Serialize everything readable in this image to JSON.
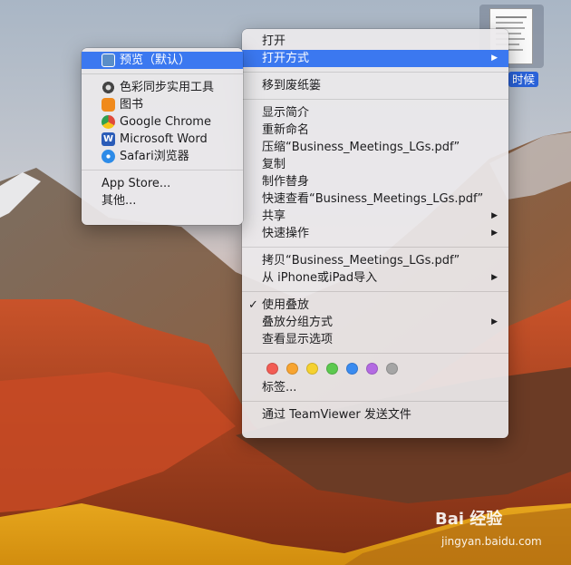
{
  "colors": {
    "accent": "#3b78f0",
    "selection_label": "#2a62d8"
  },
  "desktop": {
    "file_label": "时候",
    "watermark": "Bai 经验",
    "watermark_url": "jingyan.baidu.com"
  },
  "main_menu": {
    "items": [
      "打开",
      "打开方式",
      "移到废纸篓",
      "显示简介",
      "重新命名",
      "压缩“Business_Meetings_LGs.pdf”",
      "复制",
      "制作替身",
      "快速查看“Business_Meetings_LGs.pdf”",
      "共享",
      "快速操作",
      "拷贝“Business_Meetings_LGs.pdf”",
      "从 iPhone或iPad导入",
      "使用叠放",
      "叠放分组方式",
      "查看显示选项",
      "标签...",
      "通过 TeamViewer 发送文件"
    ],
    "tag_colors": [
      "#f25c54",
      "#f7a430",
      "#f5d12f",
      "#5cc94f",
      "#3a8bf0",
      "#b36ae2",
      "#a5a5a5"
    ],
    "checked_item": "使用叠放"
  },
  "submenu": {
    "items": [
      {
        "label": "预览（默认）",
        "icon": "preview-icon",
        "color": "#5a8ec8"
      },
      {
        "label": "色彩同步实用工具",
        "icon": "colorsync-icon",
        "color": "#444444"
      },
      {
        "label": "图书",
        "icon": "books-icon",
        "color": "#f08a1c"
      },
      {
        "label": "Google Chrome",
        "icon": "chrome-icon",
        "color": "#e04a3a"
      },
      {
        "label": "Microsoft Word",
        "icon": "word-icon",
        "color": "#2b5cb8"
      },
      {
        "label": "Safari浏览器",
        "icon": "safari-icon",
        "color": "#2d8be8"
      }
    ],
    "extra": [
      "App Store...",
      "其他..."
    ]
  }
}
